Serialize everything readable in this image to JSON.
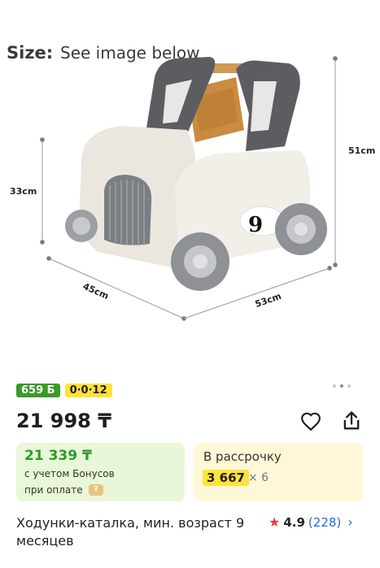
{
  "product_image": {
    "size_label": "Size:",
    "size_value": "See image below",
    "dimensions": {
      "height_total": "51cm",
      "height_seat": "33cm",
      "width": "45cm",
      "length": "53cm"
    },
    "number_decal": "9"
  },
  "gallery": {
    "dots_count": 3,
    "active_index": 1
  },
  "badges": {
    "bonus": "659 Б",
    "installment": "0·0·12"
  },
  "price": {
    "main": "21 998 ₸"
  },
  "actions": {
    "favorite_icon": "heart-icon",
    "share_icon": "share-icon"
  },
  "bonus_card": {
    "price": "21 339 ₸",
    "line1": "с учетом Бонусов",
    "line2": "при оплате"
  },
  "installment_card": {
    "title": "В рассрочку",
    "amount": "3 667",
    "multiplier": "× 6"
  },
  "product": {
    "title": "Ходунки-каталка, мин. возраст 9 месяцев",
    "rating": "4.9",
    "reviews": "(228)"
  },
  "colors": {
    "bonus_green": "#3a9a2a",
    "installment_yellow": "#ffe23a",
    "link_blue": "#2a6ad8",
    "star_red": "#e63a3a"
  }
}
